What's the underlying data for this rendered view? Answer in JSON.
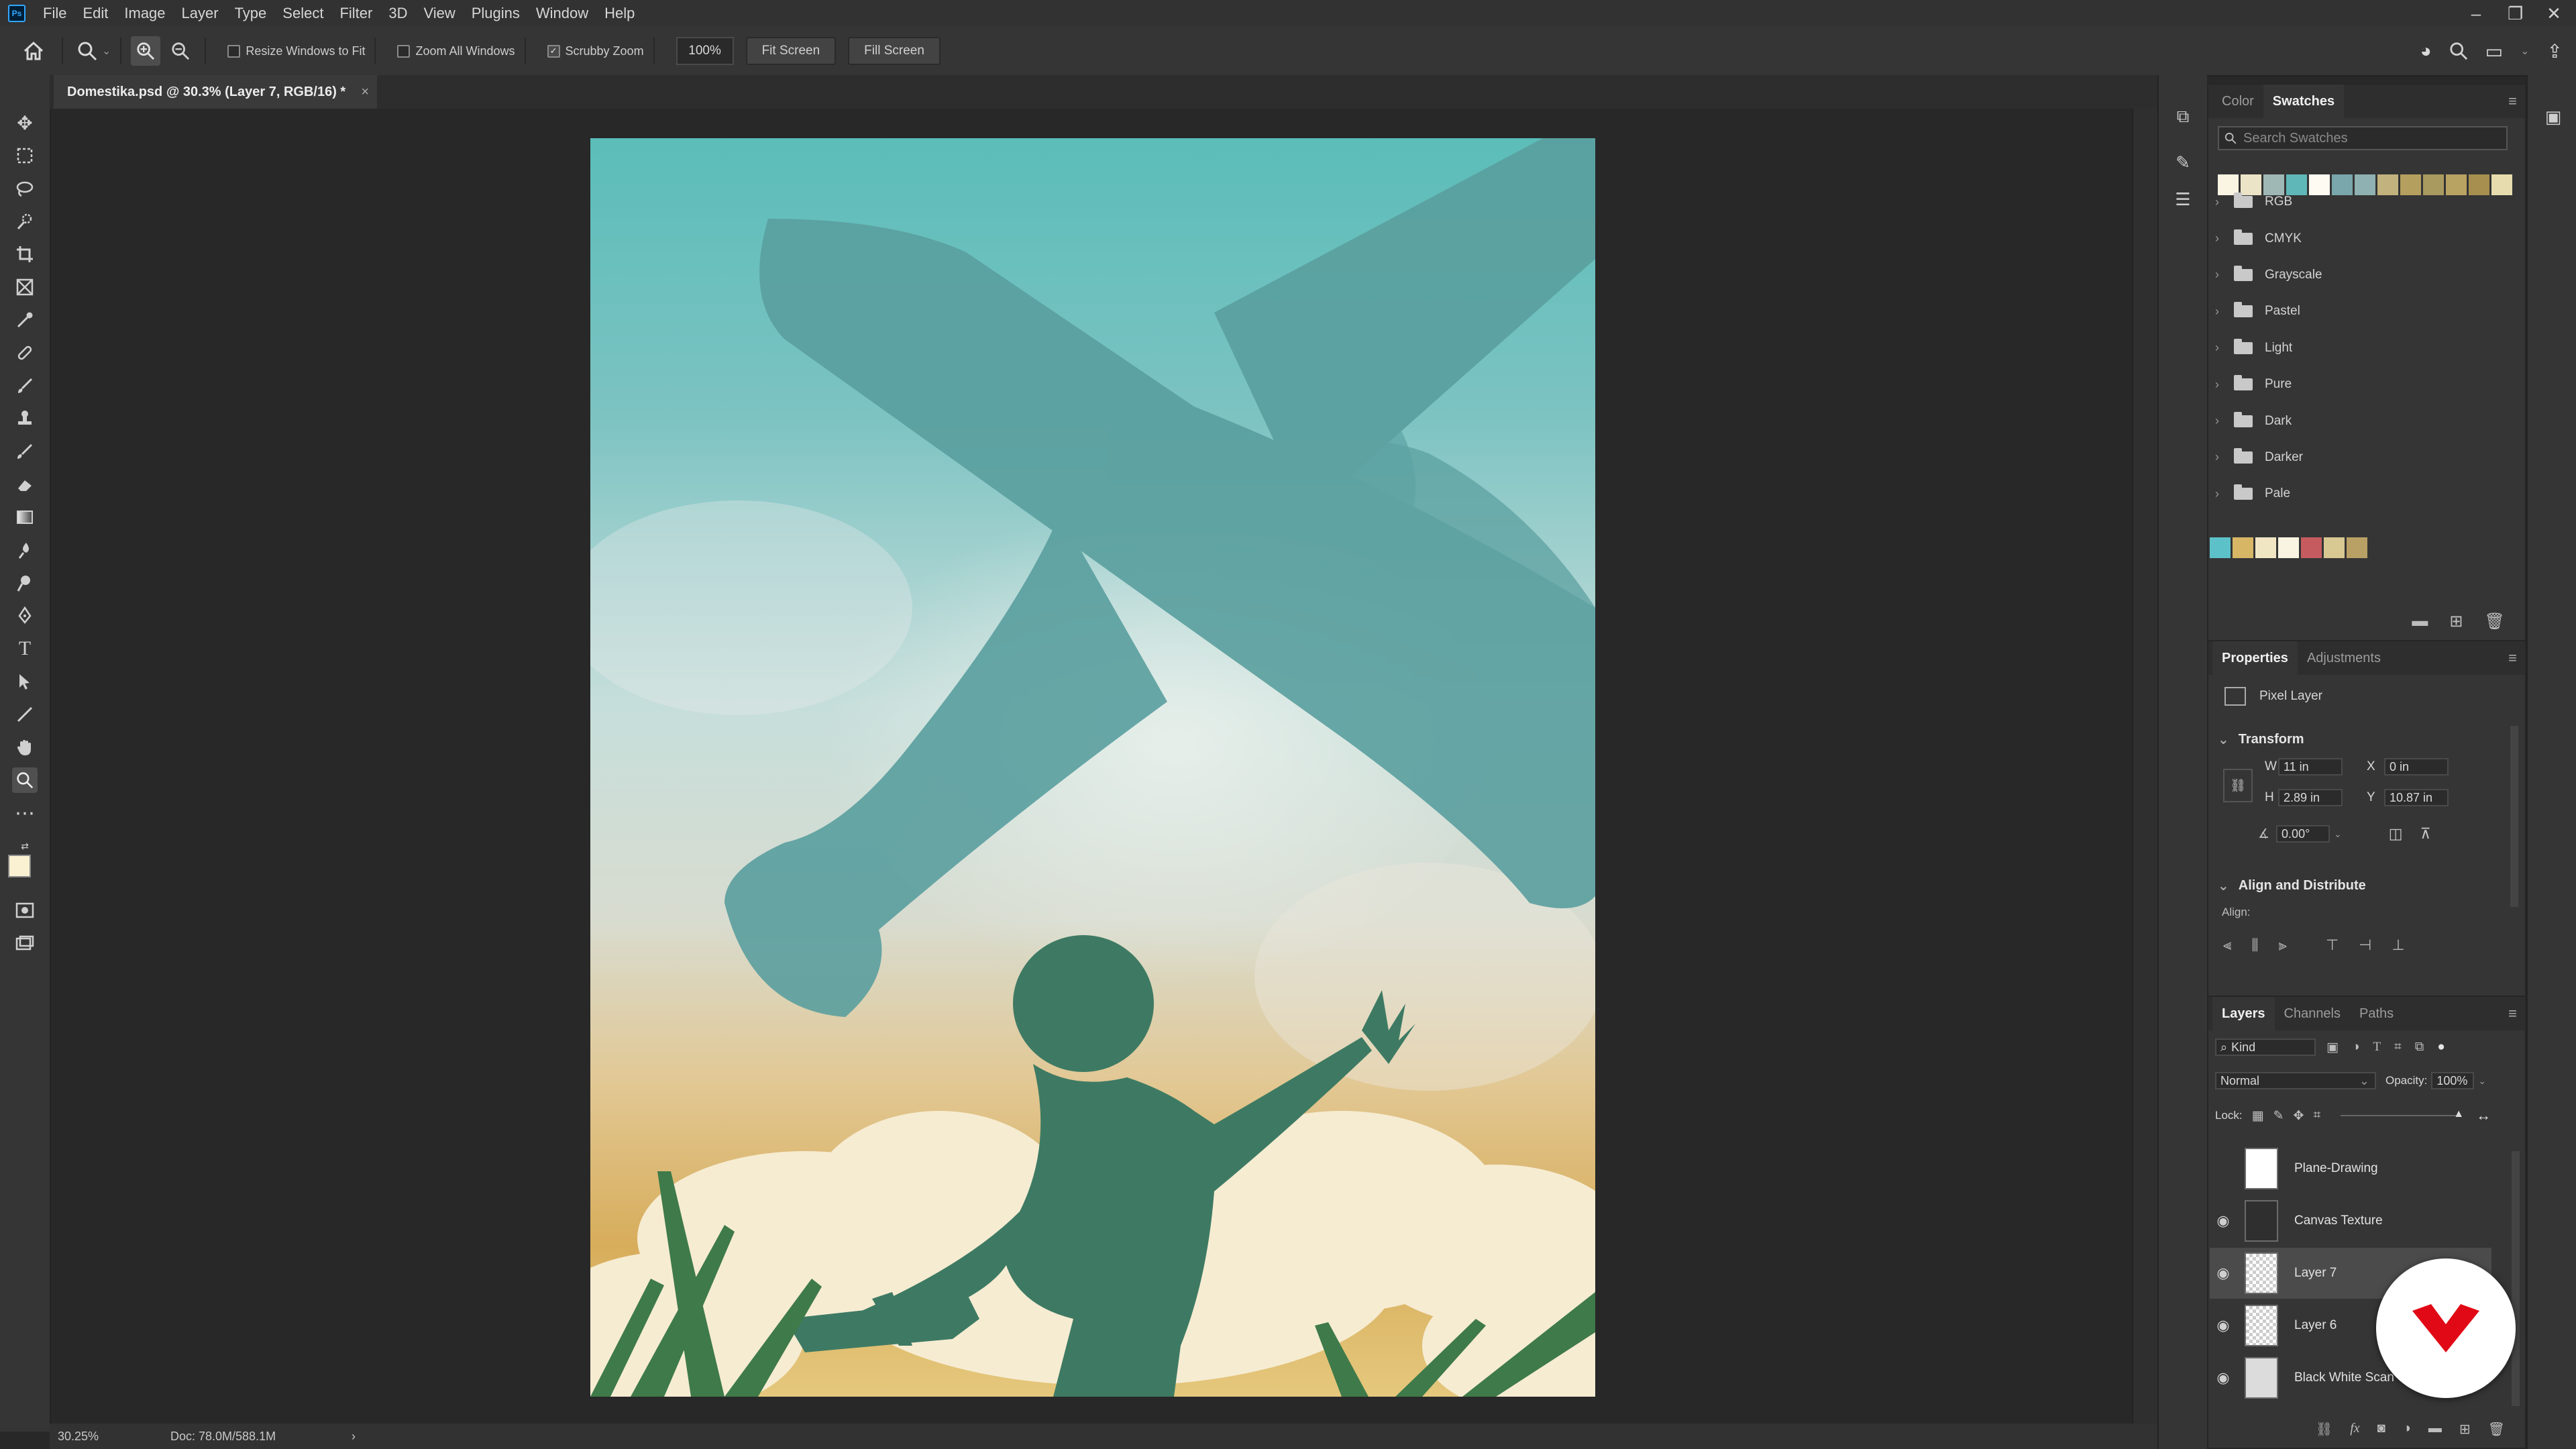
{
  "app": {
    "logo": "Ps"
  },
  "menu": [
    "File",
    "Edit",
    "Image",
    "Layer",
    "Type",
    "Select",
    "Filter",
    "3D",
    "View",
    "Plugins",
    "Window",
    "Help"
  ],
  "window_controls": [
    "minimize",
    "restore",
    "close"
  ],
  "options": {
    "resize_windows": "Resize Windows to Fit",
    "zoom_all": "Zoom All Windows",
    "scrubby_zoom": "Scrubby Zoom",
    "zoom_value": "100%",
    "fit_screen": "Fit Screen",
    "fill_screen": "Fill Screen"
  },
  "document": {
    "tab": "Domestika.psd @ 30.3% (Layer 7, RGB/16) *",
    "close": "×"
  },
  "status": {
    "zoom": "30.25%",
    "doc": "Doc: 78.0M/588.1M",
    "arrow": "›"
  },
  "swatches_panel": {
    "tabs": [
      "Color",
      "Swatches"
    ],
    "search_placeholder": "Search Swatches",
    "recent": [
      "#faf4e2",
      "#ece4c6",
      "#9fb8b6",
      "#5fb7b8",
      "#fdfbf2",
      "#79a7ab",
      "#8fb1b2",
      "#c2b27e",
      "#b59f5e",
      "#a99a5f",
      "#b9a363",
      "#a68f4f",
      "#e6dcae"
    ],
    "folders": [
      "RGB",
      "CMYK",
      "Grayscale",
      "Pastel",
      "Light",
      "Pure",
      "Dark",
      "Darker",
      "Pale"
    ],
    "bottom": [
      "#5dc1c9",
      "#d7b765",
      "#f1e6c4",
      "#f9f4e2",
      "#c65b5f",
      "#d8c891",
      "#b9a064"
    ]
  },
  "properties": {
    "tabs": [
      "Properties",
      "Adjustments"
    ],
    "layer_type": "Pixel Layer",
    "transform": "Transform",
    "w_label": "W",
    "w": "11 in",
    "h_label": "H",
    "h": "2.89 in",
    "x_label": "X",
    "x": "0 in",
    "y_label": "Y",
    "y": "10.87 in",
    "angle": "0.00°",
    "align_title": "Align and Distribute",
    "align_label": "Align:"
  },
  "layers_panel": {
    "tabs": [
      "Layers",
      "Channels",
      "Paths"
    ],
    "kind": "Kind",
    "blend": "Normal",
    "opacity_label": "Opacity:",
    "opacity": "100%",
    "lock_label": "Lock:",
    "layers": [
      "Plane-Drawing",
      "Canvas Texture",
      "Layer 7",
      "Layer 6",
      "Black White Scan"
    ]
  }
}
